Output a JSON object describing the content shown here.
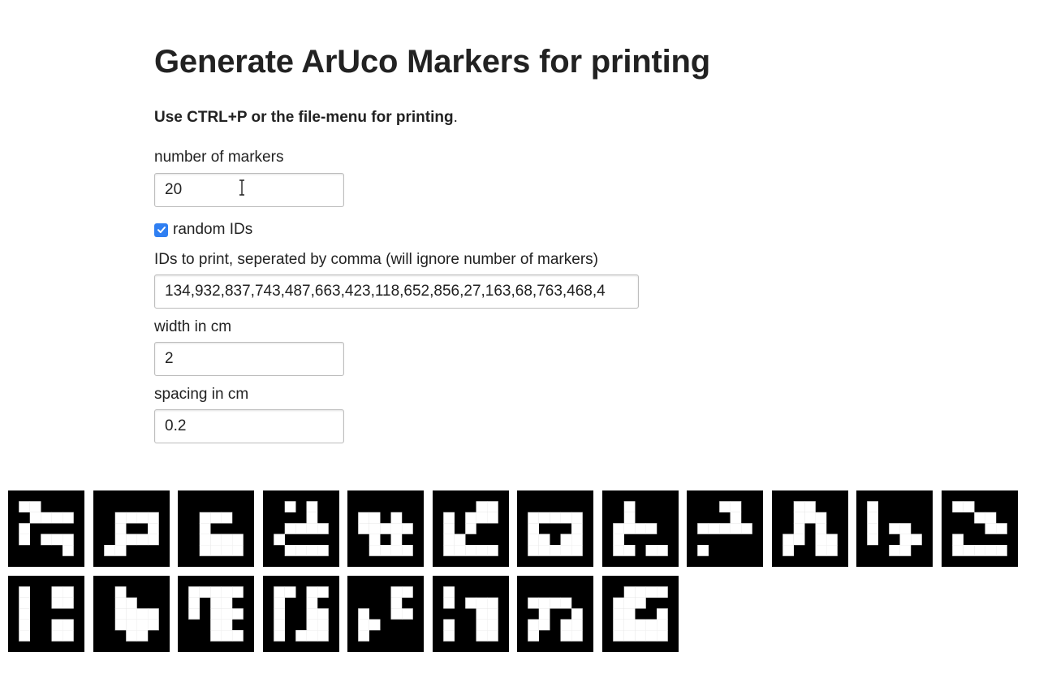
{
  "page": {
    "title": "Generate ArUco Markers for printing",
    "instructions_bold": "Use CTRL+P or the file-menu for printing",
    "instructions_tail": "."
  },
  "form": {
    "number_label": "number of markers",
    "number_value": "20",
    "random_label": "random IDs",
    "random_checked": true,
    "ids_label": "IDs to print, seperated by comma (will ignore number of markers)",
    "ids_value": "134,932,837,743,487,663,423,118,652,856,27,163,68,763,468,4",
    "width_label": "width in cm",
    "width_value": "2",
    "spacing_label": "spacing in cm",
    "spacing_value": "0.2"
  },
  "colors": {
    "checkbox": "#2f7ff2",
    "marker_black": "#000000",
    "marker_white": "#ffffff"
  },
  "markers": [
    [
      "11000",
      "01111",
      "10000",
      "10111",
      "00001"
    ],
    [
      "00000",
      "01111",
      "01001",
      "01111",
      "11000"
    ],
    [
      "00000",
      "01110",
      "01000",
      "01111",
      "01111"
    ],
    [
      "01010",
      "00010",
      "01111",
      "10000",
      "01111"
    ],
    [
      "00000",
      "11010",
      "11111",
      "01010",
      "01111"
    ],
    [
      "00011",
      "10111",
      "10100",
      "11000",
      "11111"
    ],
    [
      "00000",
      "11111",
      "10001",
      "11011",
      "11111"
    ],
    [
      "01000",
      "01000",
      "11110",
      "10000",
      "11011"
    ],
    [
      "00110",
      "00010",
      "11111",
      "00000",
      "10000"
    ],
    [
      "01100",
      "01110",
      "01010",
      "11011",
      "10011"
    ],
    [
      "10000",
      "10000",
      "10110",
      "10011",
      "00110"
    ],
    [
      "11000",
      "00110",
      "00011",
      "10000",
      "11111"
    ],
    [
      "10011",
      "10011",
      "10000",
      "10011",
      "10011"
    ],
    [
      "01000",
      "01100",
      "01111",
      "01111",
      "00110"
    ],
    [
      "11111",
      "10110",
      "10111",
      "00110",
      "00111"
    ],
    [
      "11011",
      "10010",
      "10011",
      "10011",
      "10111"
    ],
    [
      "00011",
      "00010",
      "10011",
      "11000",
      "10000"
    ],
    [
      "10000",
      "10111",
      "00011",
      "10011",
      "10011"
    ],
    [
      "00000",
      "11110",
      "01001",
      "11011",
      "10011"
    ],
    [
      "01111",
      "11100",
      "11001",
      "11111",
      "11111"
    ]
  ]
}
